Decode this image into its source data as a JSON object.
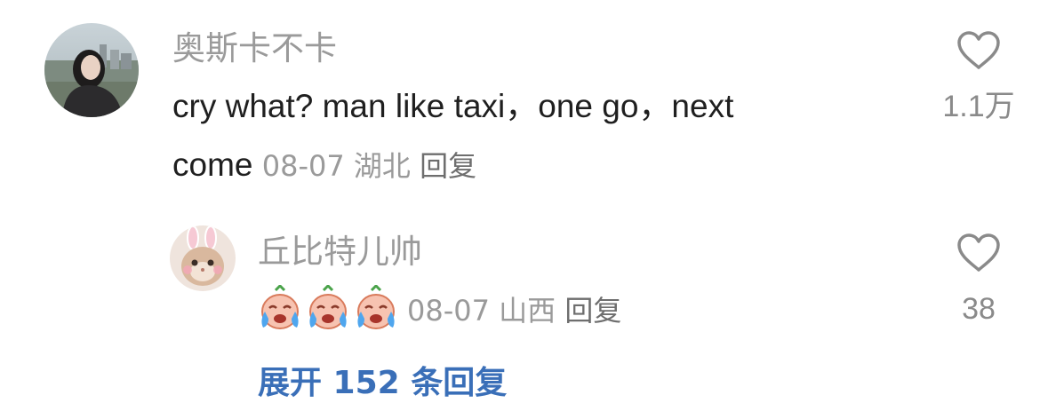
{
  "comments": [
    {
      "username": "奥斯卡不卡",
      "text_line1": "cry what?  man like taxi，one go，next",
      "text_line2": "come",
      "date": "08-07",
      "location": "湖北",
      "reply_label": "回复",
      "likes": "1.1万",
      "avatar_icon": "woman-portrait-avatar"
    },
    {
      "username": "丘比特儿帅",
      "emojis": [
        "crying-face-emoji",
        "crying-face-emoji",
        "crying-face-emoji"
      ],
      "date": "08-07",
      "location": "山西",
      "reply_label": "回复",
      "likes": "38",
      "avatar_icon": "cat-with-bunny-ears-avatar"
    }
  ],
  "expand_replies": "展开 152 条回复",
  "colors": {
    "username": "#9a9a9a",
    "text": "#1f1f1f",
    "meta": "#9a9a9a",
    "link": "#3a6fb8"
  }
}
